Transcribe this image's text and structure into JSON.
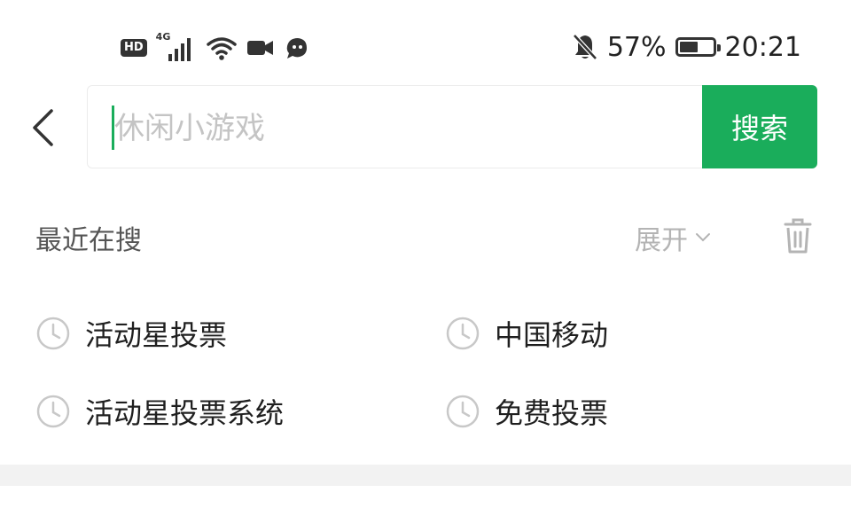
{
  "status_bar": {
    "hd": "HD",
    "network": "4G",
    "battery_percent": "57%",
    "battery_level": 0.57,
    "time": "20:21"
  },
  "search": {
    "placeholder": "休闲小游戏",
    "value": "",
    "button_label": "搜索"
  },
  "recent": {
    "title": "最近在搜",
    "expand_label": "展开",
    "items": [
      {
        "label": "活动星投票"
      },
      {
        "label": "中国移动"
      },
      {
        "label": "活动星投票系统"
      },
      {
        "label": "免费投票"
      }
    ]
  },
  "colors": {
    "accent": "#1aad5b",
    "text": "#1f1f1f",
    "muted": "#b4b4b4",
    "divider": "#f2f2f2"
  },
  "icons": {
    "back": "chevron-left-icon",
    "clear": "trash-icon",
    "history": "clock-icon",
    "expand": "chevron-down-icon"
  }
}
